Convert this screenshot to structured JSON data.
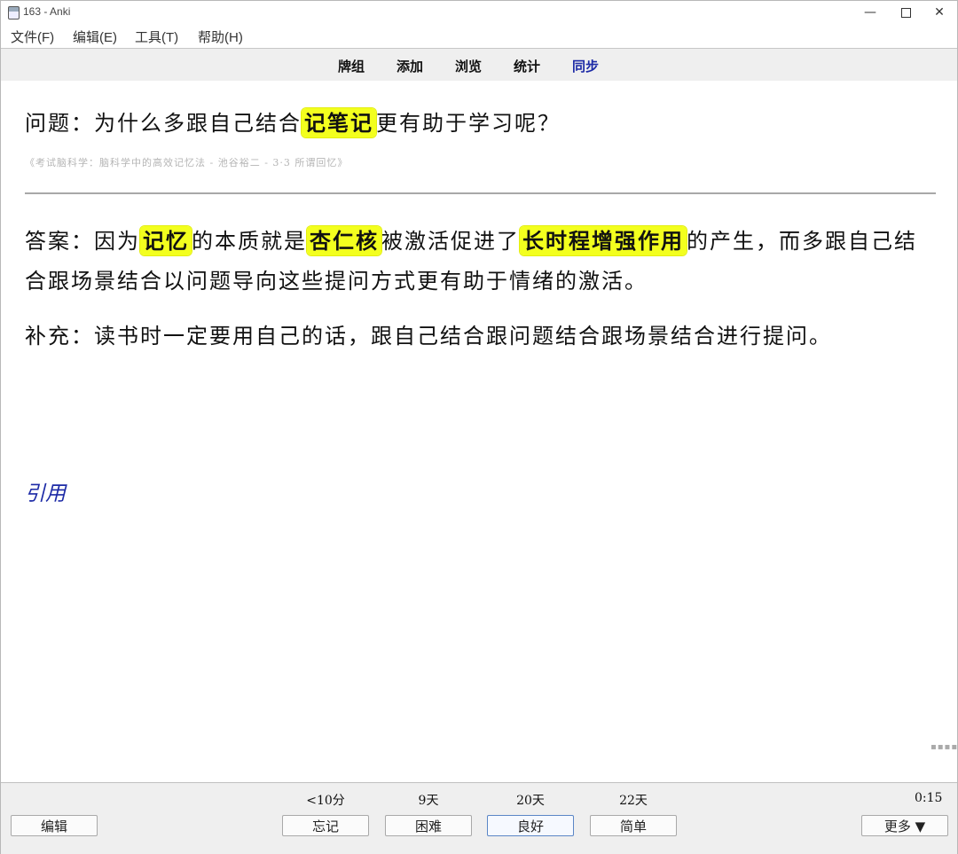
{
  "window": {
    "title": "163 - Anki"
  },
  "menu": [
    "文件(F)",
    "编辑(E)",
    "工具(T)",
    "帮助(H)"
  ],
  "toolbar": {
    "decks": "牌组",
    "add": "添加",
    "browse": "浏览",
    "stats": "统计",
    "sync": "同步"
  },
  "card": {
    "question": {
      "prefix": "问题：为什么多跟自己结合",
      "highlight": "记笔记",
      "suffix": "更有助于学习呢？"
    },
    "source": "《考试脑科学：脑科学中的高效记忆法 - 池谷裕二 - 3·3 所谓回忆》",
    "answer": {
      "p1": "答案：因为",
      "h1": "记忆",
      "p2": "的本质就是",
      "h2": "杏仁核",
      "p3": "被激活促进了",
      "h3": "长时程增强作用",
      "p4": "的产生，而多跟自己结合跟场景结合以问题导向这些提问方式更有助于情绪的激活。"
    },
    "supplement": "补充：读书时一定要用自己的话，跟自己结合跟问题结合跟场景结合进行提问。",
    "cite": "引用"
  },
  "bottom": {
    "edit": "编辑",
    "more": "更多 ▼",
    "timer": "0:15",
    "answers": [
      {
        "interval": "<10分",
        "label": "忘记"
      },
      {
        "interval": "9天",
        "label": "困难"
      },
      {
        "interval": "20天",
        "label": "良好"
      },
      {
        "interval": "22天",
        "label": "简单"
      }
    ]
  }
}
